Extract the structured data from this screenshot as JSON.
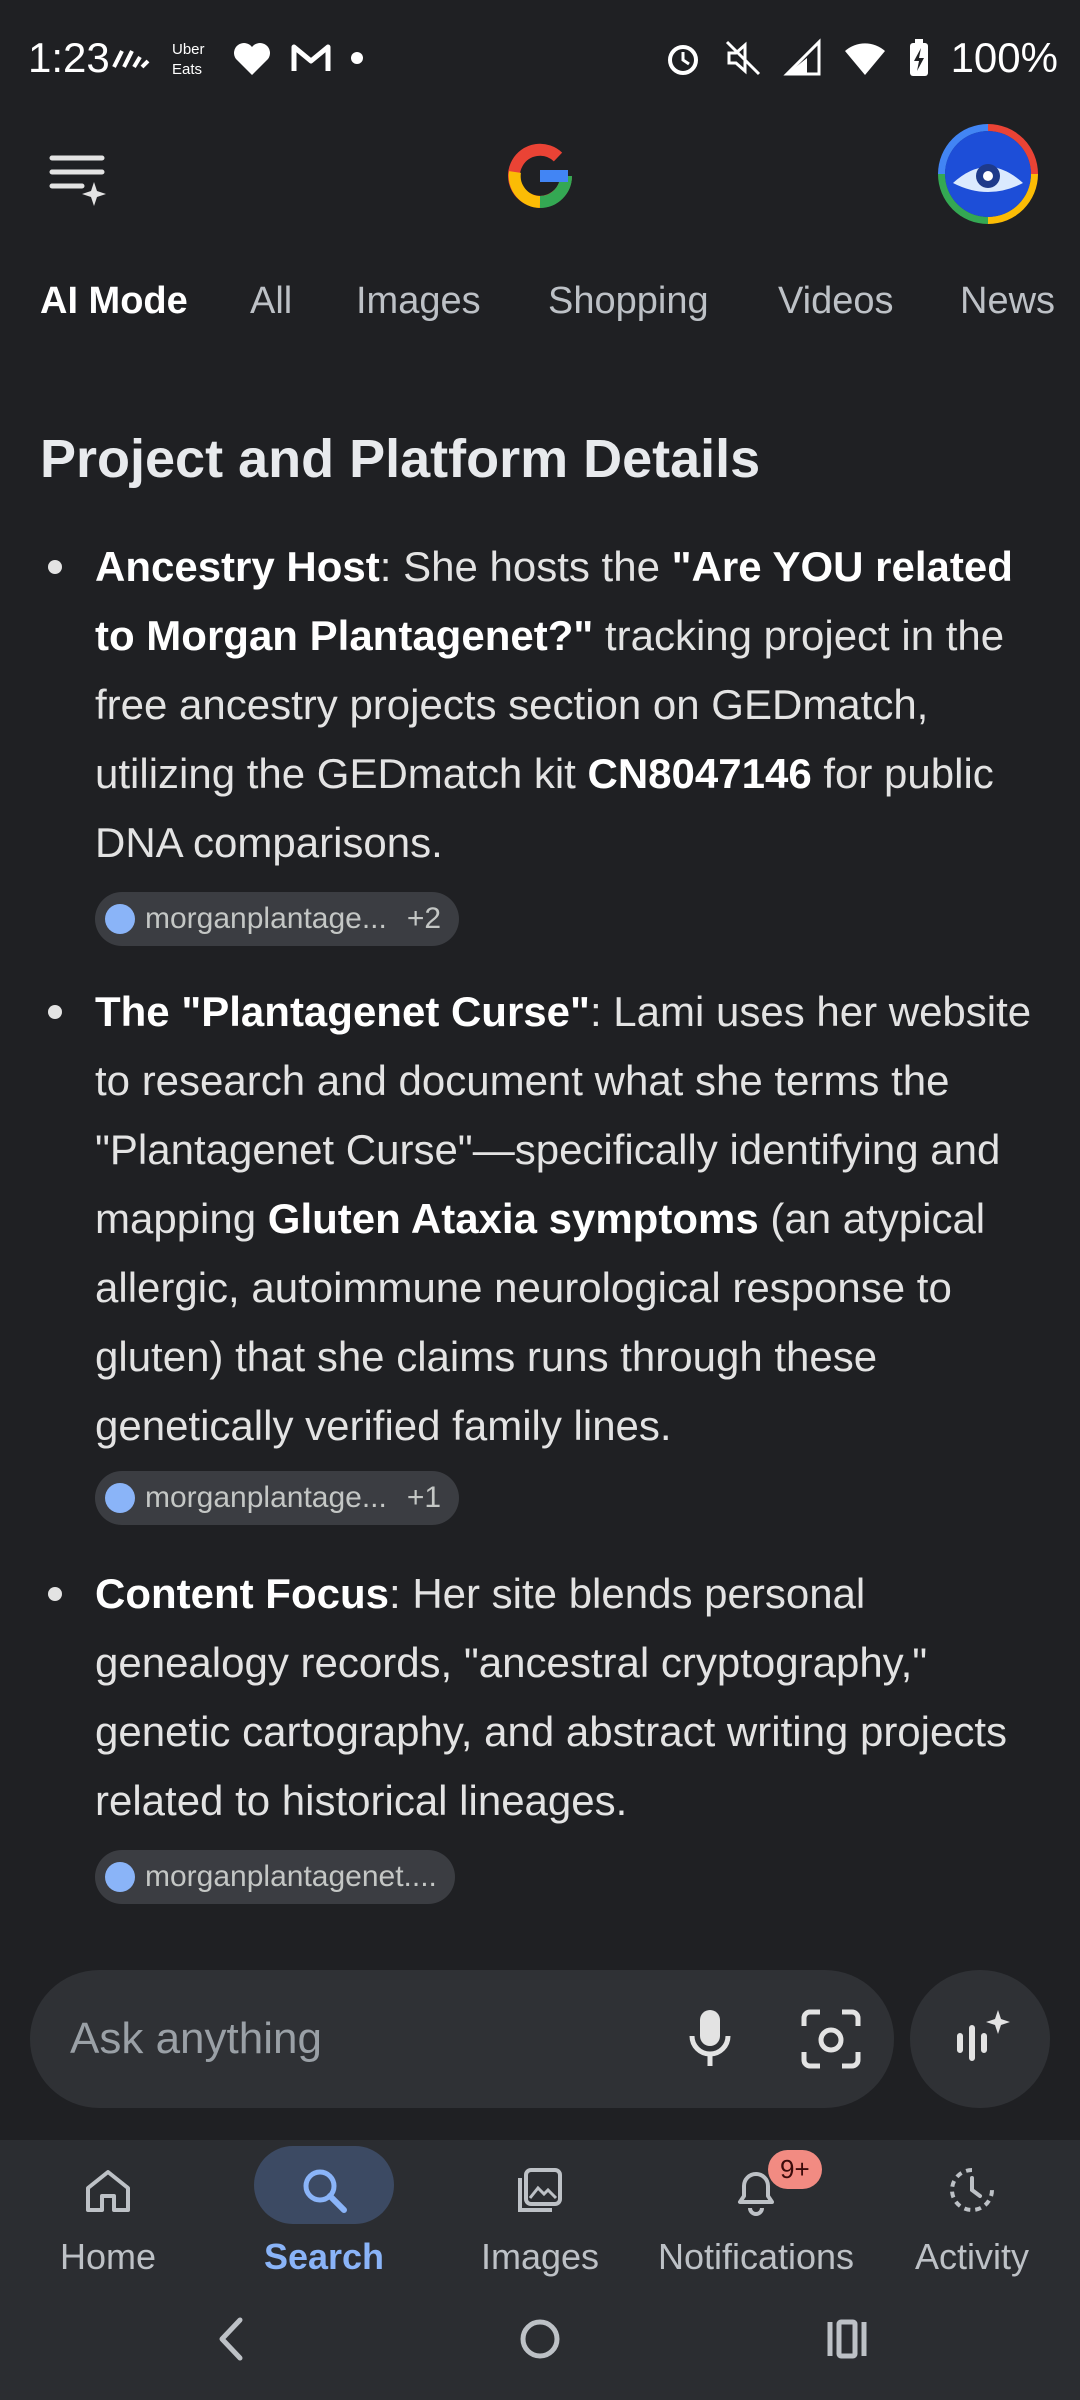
{
  "status_bar": {
    "time": "1:23",
    "battery": "100%",
    "left_icons": [
      "wave-icon",
      "uber-eats-icon",
      "heart-icon",
      "gmail-icon",
      "dot-icon"
    ],
    "right_icons": [
      "alarm-icon",
      "mute-icon",
      "signal-icon",
      "wifi-icon",
      "battery-icon"
    ]
  },
  "header": {
    "logo": "G",
    "menu_icon": "menu-sparkle-icon",
    "avatar": "avatar"
  },
  "tabs": [
    "AI Mode",
    "All",
    "Images",
    "Shopping",
    "Videos",
    "News"
  ],
  "content": {
    "title": "Project and Platform Details",
    "items": [
      {
        "label": "Ancestry Host",
        "chip": "morganplantage...",
        "chip_more": "+2"
      },
      {
        "label": "The \"Plantagenet Curse\"",
        "chip": "morganplantage...",
        "chip_more": "+1"
      },
      {
        "label": "Content Focus",
        "chip": "morganplantagenet...."
      }
    ],
    "item1_parts": {
      "t1": ": She hosts the ",
      "b1": "\"Are YOU related to Morgan Plantagenet?\"",
      "t2": " tracking project in the free ancestry projects section on GEDmatch, utilizing the GEDmatch kit ",
      "b2": "CN8047146",
      "t3": " for public DNA comparisons."
    },
    "item2_parts": {
      "t1": ": Lami uses her website to research and document what she terms the \"Plantagenet Curse\"—specifically identifying and mapping ",
      "b1": "Gluten Ataxia symptoms",
      "t2": " (an atypical allergic, autoimmune neurological response to gluten) that she claims runs through these genetically verified family lines. "
    },
    "item3_parts": {
      "t1": ": Her site blends personal genealogy records, \"ancestral cryptography,\" genetic cartography, and abstract writing projects related to historical lineages."
    }
  },
  "ask": {
    "placeholder": "Ask anything"
  },
  "bottom_nav": {
    "items": [
      {
        "label": "Home",
        "icon": "home-icon"
      },
      {
        "label": "Search",
        "icon": "search-icon",
        "active": true
      },
      {
        "label": "Images",
        "icon": "images-icon"
      },
      {
        "label": "Notifications",
        "icon": "bell-icon",
        "badge": "9+"
      },
      {
        "label": "Activity",
        "icon": "activity-icon"
      }
    ]
  },
  "colors": {
    "background": "#1f2023",
    "accent": "#8ab4f8",
    "badge": "#f28b82"
  }
}
